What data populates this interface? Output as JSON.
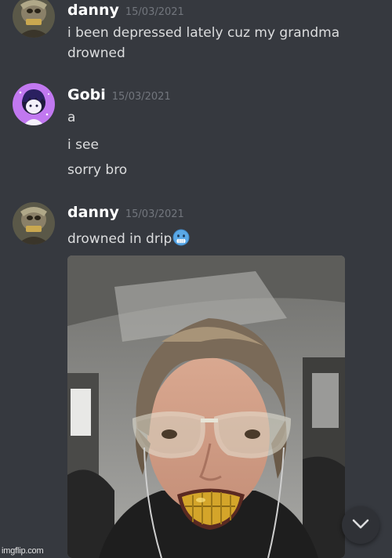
{
  "messages": [
    {
      "username": "danny",
      "timestamp": "15/03/2021",
      "avatar_icon": "danny-avatar-icon",
      "lines": [
        "i been depressed lately cuz my grandma",
        "drowned"
      ]
    },
    {
      "username": "Gobi",
      "timestamp": "15/03/2021",
      "avatar_icon": "gobi-avatar-icon",
      "avatar_color": "#c178f0",
      "lines": [
        "a",
        "i see",
        "sorry bro"
      ]
    },
    {
      "username": "danny",
      "timestamp": "15/03/2021",
      "avatar_icon": "danny-avatar-icon",
      "lines": [
        "drowned in drip"
      ],
      "emoji": "cold-face-emoji",
      "attachment": "image-attachment"
    }
  ],
  "scroll_button_icon": "chevron-down-icon",
  "watermark": "imgflip.com",
  "colors": {
    "background": "#36393f",
    "username": "#ffffff",
    "timestamp": "#72767d",
    "message_text": "#dcddde",
    "emoji_blue": "#5aa8e6"
  }
}
